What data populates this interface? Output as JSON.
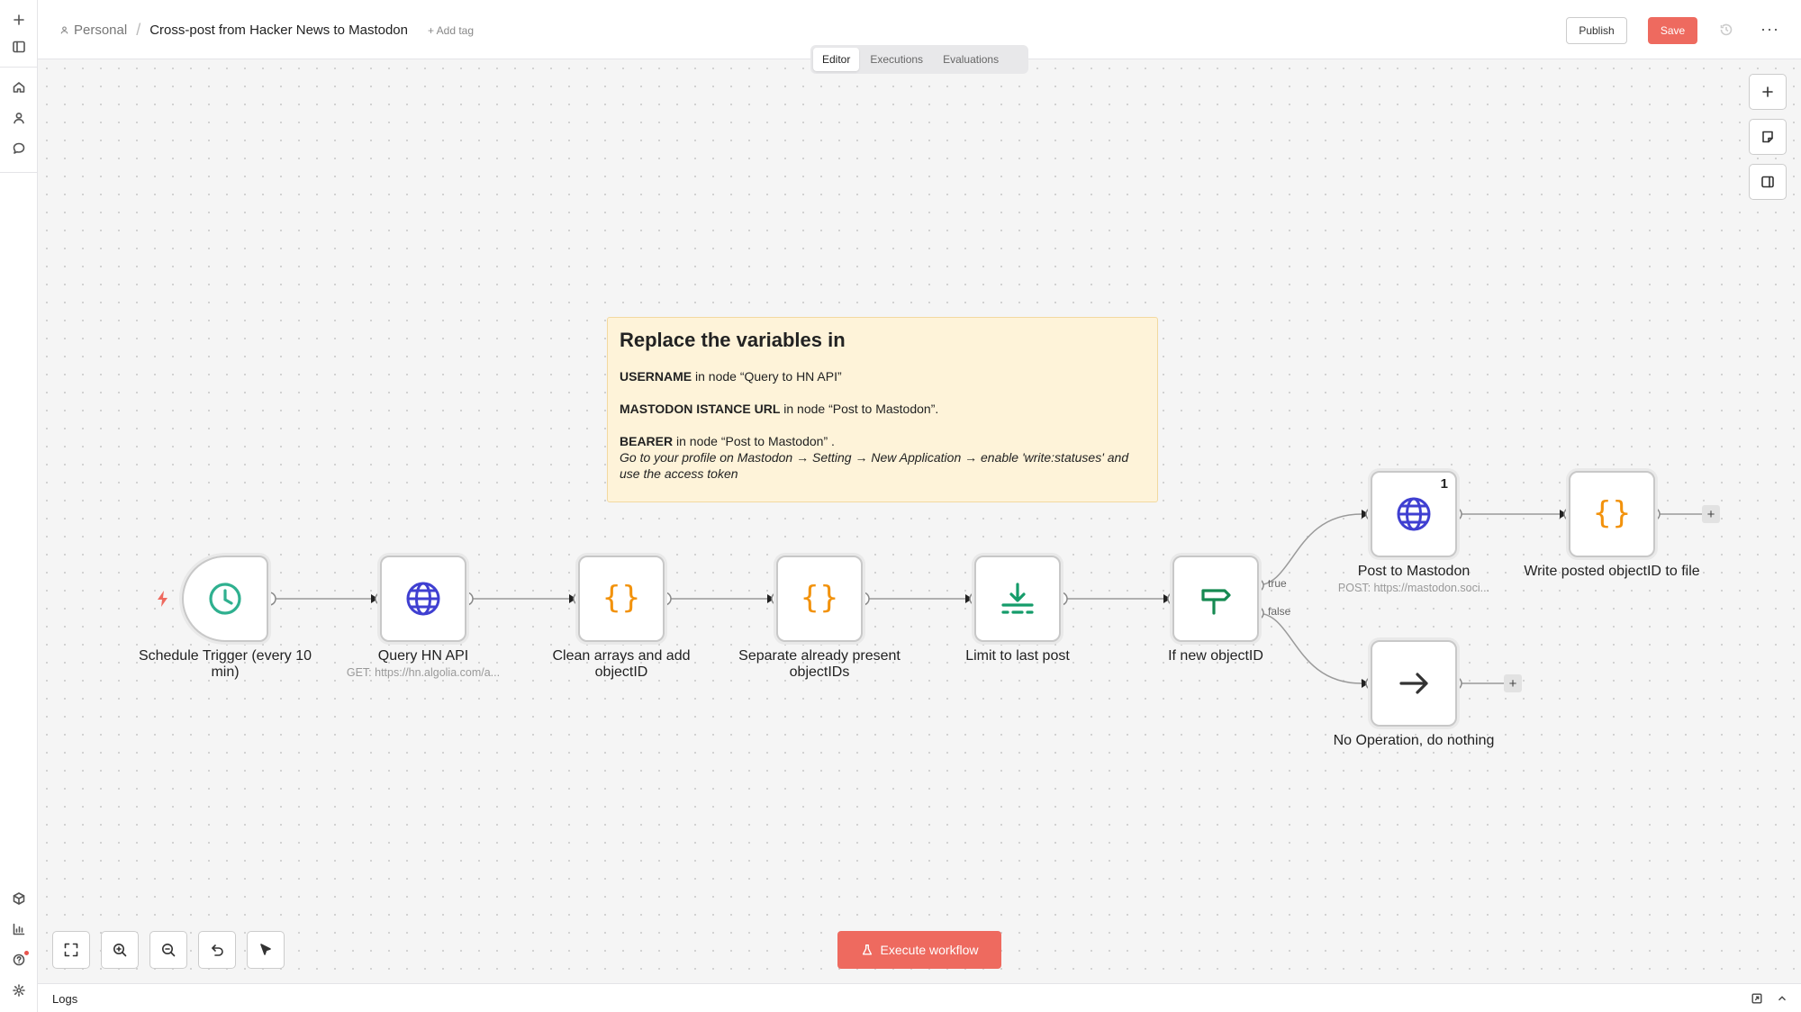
{
  "header": {
    "project": "Personal",
    "workflow_name": "Cross-post from Hacker News to Mastodon",
    "add_tag": "+ Add tag",
    "publish_label": "Publish",
    "save_label": "Save",
    "more": "···"
  },
  "tabs": [
    {
      "label": "Editor",
      "active": true
    },
    {
      "label": "Executions",
      "active": false
    },
    {
      "label": "Evaluations",
      "active": false
    }
  ],
  "sticky": {
    "title": "Replace the variables in",
    "line1_bold": "USERNAME",
    "line1_rest": " in node “Query to HN API”",
    "line2_bold": "MASTODON ISTANCE URL",
    "line2_rest": " in node “Post to Mastodon”.",
    "line3_bold": "BEARER",
    "line3_rest": " in node “Post to Mastodon” .",
    "line4_italic": "Go to your profile on Mastodon → Setting → New Application → enable 'write:statuses' and use the access token"
  },
  "nodes": [
    {
      "id": "schedule",
      "label": "Schedule Trigger (every 10 min)",
      "subtitle": "",
      "icon": "clock-icon"
    },
    {
      "id": "query_hn",
      "label": "Query HN API",
      "subtitle": "GET: https://hn.algolia.com/a...",
      "icon": "globe-icon"
    },
    {
      "id": "clean",
      "label": "Clean arrays and add objectID",
      "subtitle": "",
      "icon": "code-braces-icon"
    },
    {
      "id": "separate",
      "label": "Separate already present objectIDs",
      "subtitle": "",
      "icon": "code-braces-icon"
    },
    {
      "id": "limit",
      "label": "Limit to last post",
      "subtitle": "",
      "icon": "limit-icon"
    },
    {
      "id": "if",
      "label": "If new objectID",
      "subtitle": "",
      "icon": "signpost-icon"
    },
    {
      "id": "post",
      "label": "Post to Mastodon",
      "subtitle": "POST: https://mastodon.soci...",
      "icon": "globe-icon",
      "count": "1"
    },
    {
      "id": "write",
      "label": "Write posted objectID to file",
      "subtitle": "",
      "icon": "code-braces-icon"
    },
    {
      "id": "noop",
      "label": "No Operation, do nothing",
      "subtitle": "",
      "icon": "arrow-right-icon"
    }
  ],
  "branches": {
    "true_label": "true",
    "false_label": "false"
  },
  "execute_label": "Execute workflow",
  "logs_label": "Logs",
  "colors": {
    "accent": "#ee6a5f",
    "clock": "#2fb08f",
    "globe": "#3f3fd1",
    "code": "#f2920c",
    "limit": "#159c6a",
    "signpost": "#168a52"
  }
}
